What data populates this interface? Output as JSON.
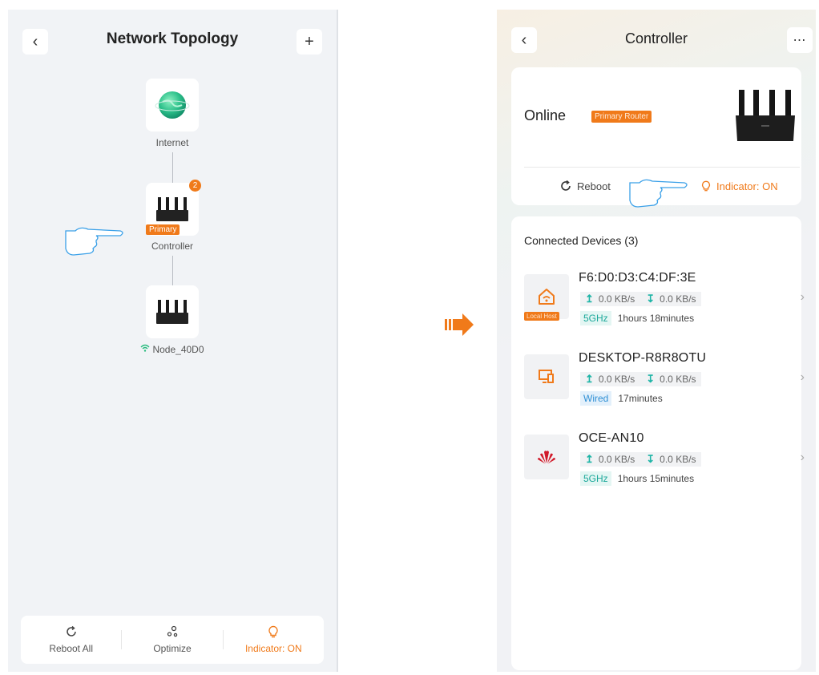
{
  "left": {
    "title": "Network Topology",
    "back_icon": "chevron-left-icon",
    "add_icon": "plus-icon",
    "internet_label": "Internet",
    "controller_label": "Controller",
    "controller_badge": "2",
    "primary_tag": "Primary",
    "node_label": "Node_40D0",
    "bottom": {
      "reboot_all": "Reboot All",
      "optimize": "Optimize",
      "indicator": "Indicator: ON"
    }
  },
  "right": {
    "title": "Controller",
    "back_icon": "chevron-left-icon",
    "more_icon": "more-horizontal-icon",
    "status": "Online",
    "router_tag": "Primary Router",
    "reboot": "Reboot",
    "indicator": "Indicator: ON",
    "devices_title": "Connected Devices (3)",
    "devices": [
      {
        "name": "F6:D0:D3:C4:DF:3E",
        "icon": "house-wifi-icon",
        "tag": "Local Host",
        "up": "0.0 KB/s",
        "down": "0.0 KB/s",
        "band": "5GHz",
        "duration": "1hours 18minutes"
      },
      {
        "name": "DESKTOP-R8R8OTU",
        "icon": "desktop-icon",
        "tag": "",
        "up": "0.0 KB/s",
        "down": "0.0 KB/s",
        "band": "Wired",
        "duration": "17minutes"
      },
      {
        "name": "OCE-AN10",
        "icon": "huawei-logo-icon",
        "tag": "",
        "up": "0.0 KB/s",
        "down": "0.0 KB/s",
        "band": "5GHz",
        "duration": "1hours 15minutes"
      }
    ]
  },
  "colors": {
    "accent": "#f07a1a",
    "teal": "#1db4a6",
    "wired_blue": "#2e8fd4",
    "hand_outline": "#3aa0e8"
  }
}
